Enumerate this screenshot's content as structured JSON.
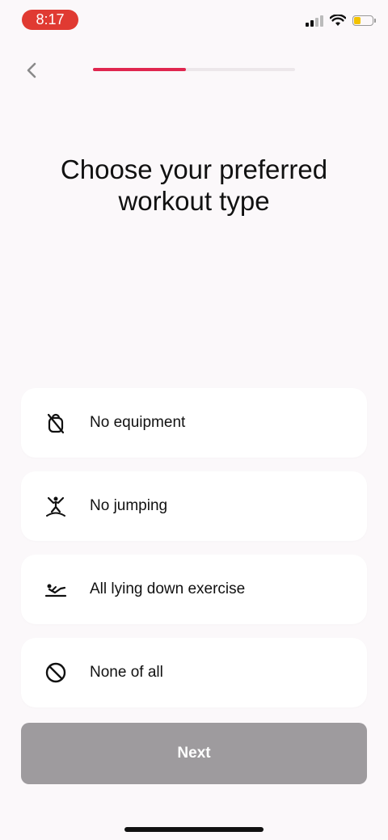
{
  "status_bar": {
    "time": "8:17",
    "icons": [
      "signal-icon",
      "wifi-icon",
      "battery-icon"
    ],
    "time_pill_color": "#e03a32",
    "battery_level": 0.35
  },
  "navigation": {
    "back_icon": "chevron-left-icon",
    "progress": 0.46,
    "progress_color": "#e0264f"
  },
  "page": {
    "title": "Choose your preferred workout type"
  },
  "options": [
    {
      "label": "No equipment",
      "icon": "kettlebell-crossed-icon"
    },
    {
      "label": "No jumping",
      "icon": "jumping-person-icon"
    },
    {
      "label": "All lying down exercise",
      "icon": "lying-exercise-icon"
    },
    {
      "label": "None of all",
      "icon": "prohibited-icon"
    }
  ],
  "next_button": {
    "label": "Next",
    "color": "#9e9b9e"
  }
}
